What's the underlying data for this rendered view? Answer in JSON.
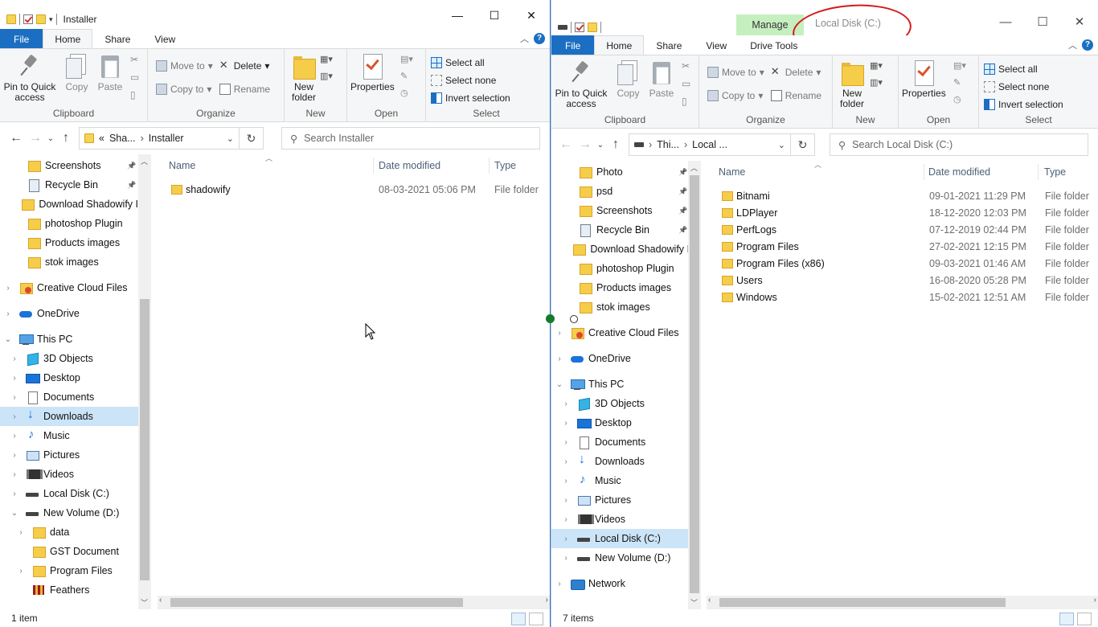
{
  "left": {
    "title": "Installer",
    "window_controls": {
      "minimize": "—",
      "maximize": "☐",
      "close": "✕"
    },
    "tabs": {
      "file": "File",
      "home": "Home",
      "share": "Share",
      "view": "View"
    },
    "ribbon": {
      "clipboard": {
        "label": "Clipboard",
        "pin": "Pin to Quick access",
        "copy": "Copy",
        "paste": "Paste"
      },
      "organize": {
        "label": "Organize",
        "move_to": "Move to",
        "copy_to": "Copy to",
        "delete": "Delete",
        "rename": "Rename"
      },
      "new": {
        "label": "New",
        "new_folder": "New folder"
      },
      "open": {
        "label": "Open",
        "properties": "Properties"
      },
      "select": {
        "label": "Select",
        "select_all": "Select all",
        "select_none": "Select none",
        "invert": "Invert selection"
      }
    },
    "address": {
      "crumb1": "Sha...",
      "crumb2": "Installer",
      "prefix": "«"
    },
    "search_placeholder": "Search Installer",
    "nav": [
      {
        "label": "Screenshots",
        "icon": "folder",
        "pinned": true
      },
      {
        "label": "Recycle Bin",
        "icon": "recycle-bin",
        "pinned": true
      },
      {
        "label": "Download Shadowify I",
        "icon": "folder"
      },
      {
        "label": "photoshop Plugin",
        "icon": "folder"
      },
      {
        "label": "Products images",
        "icon": "folder"
      },
      {
        "label": "stok images",
        "icon": "folder"
      },
      {
        "label": "Creative Cloud Files",
        "icon": "creative-cloud"
      },
      {
        "label": "OneDrive",
        "icon": "onedrive"
      },
      {
        "label": "This PC",
        "icon": "pc"
      },
      {
        "label": "3D Objects",
        "icon": "3d"
      },
      {
        "label": "Desktop",
        "icon": "desktop"
      },
      {
        "label": "Documents",
        "icon": "documents"
      },
      {
        "label": "Downloads",
        "icon": "downloads"
      },
      {
        "label": "Music",
        "icon": "music"
      },
      {
        "label": "Pictures",
        "icon": "pictures"
      },
      {
        "label": "Videos",
        "icon": "videos"
      },
      {
        "label": "Local Disk (C:)",
        "icon": "drive"
      },
      {
        "label": "New Volume (D:)",
        "icon": "drive"
      },
      {
        "label": "data",
        "icon": "folder"
      },
      {
        "label": "GST Document",
        "icon": "folder"
      },
      {
        "label": "Program Files",
        "icon": "folder"
      },
      {
        "label": "Feathers",
        "icon": "feathers"
      }
    ],
    "columns": {
      "name": "Name",
      "date": "Date modified",
      "type": "Type"
    },
    "files": [
      {
        "name": "shadowify",
        "date": "08-03-2021 05:06 PM",
        "type": "File folder"
      }
    ],
    "status": "1 item"
  },
  "right": {
    "title": "Local Disk (C:)",
    "manage": "Manage",
    "window_controls": {
      "minimize": "—",
      "maximize": "☐",
      "close": "✕"
    },
    "tabs": {
      "file": "File",
      "home": "Home",
      "share": "Share",
      "view": "View",
      "drive_tools": "Drive Tools"
    },
    "ribbon": {
      "clipboard": {
        "label": "Clipboard",
        "pin": "Pin to Quick access",
        "copy": "Copy",
        "paste": "Paste"
      },
      "organize": {
        "label": "Organize",
        "move_to": "Move to",
        "copy_to": "Copy to",
        "delete": "Delete",
        "rename": "Rename"
      },
      "new": {
        "label": "New",
        "new_folder": "New folder"
      },
      "open": {
        "label": "Open",
        "properties": "Properties"
      },
      "select": {
        "label": "Select",
        "select_all": "Select all",
        "select_none": "Select none",
        "invert": "Invert selection"
      }
    },
    "address": {
      "crumb1": "Thi...",
      "crumb2": "Local ..."
    },
    "search_placeholder": "Search Local Disk (C:)",
    "nav": [
      {
        "label": "Photo",
        "icon": "folder",
        "pinned": true
      },
      {
        "label": "psd",
        "icon": "folder",
        "pinned": true
      },
      {
        "label": "Screenshots",
        "icon": "folder",
        "pinned": true
      },
      {
        "label": "Recycle Bin",
        "icon": "recycle-bin",
        "pinned": true
      },
      {
        "label": "Download Shadowify I",
        "icon": "folder"
      },
      {
        "label": "photoshop Plugin",
        "icon": "folder"
      },
      {
        "label": "Products images",
        "icon": "folder"
      },
      {
        "label": "stok images",
        "icon": "folder"
      },
      {
        "label": "Creative Cloud Files",
        "icon": "creative-cloud"
      },
      {
        "label": "OneDrive",
        "icon": "onedrive"
      },
      {
        "label": "This PC",
        "icon": "pc"
      },
      {
        "label": "3D Objects",
        "icon": "3d"
      },
      {
        "label": "Desktop",
        "icon": "desktop"
      },
      {
        "label": "Documents",
        "icon": "documents"
      },
      {
        "label": "Downloads",
        "icon": "downloads"
      },
      {
        "label": "Music",
        "icon": "music"
      },
      {
        "label": "Pictures",
        "icon": "pictures"
      },
      {
        "label": "Videos",
        "icon": "videos"
      },
      {
        "label": "Local Disk (C:)",
        "icon": "drive"
      },
      {
        "label": "New Volume (D:)",
        "icon": "drive"
      },
      {
        "label": "Network",
        "icon": "network"
      }
    ],
    "columns": {
      "name": "Name",
      "date": "Date modified",
      "type": "Type"
    },
    "files": [
      {
        "name": "Bitnami",
        "date": "09-01-2021 11:29 PM",
        "type": "File folder"
      },
      {
        "name": "LDPlayer",
        "date": "18-12-2020 12:03 PM",
        "type": "File folder"
      },
      {
        "name": "PerfLogs",
        "date": "07-12-2019 02:44 PM",
        "type": "File folder"
      },
      {
        "name": "Program Files",
        "date": "27-02-2021 12:15 PM",
        "type": "File folder"
      },
      {
        "name": "Program Files (x86)",
        "date": "09-03-2021 01:46 AM",
        "type": "File folder"
      },
      {
        "name": "Users",
        "date": "16-08-2020 05:28 PM",
        "type": "File folder"
      },
      {
        "name": "Windows",
        "date": "15-02-2021 12:51 AM",
        "type": "File folder"
      }
    ],
    "status": "7 items"
  },
  "colors": {
    "accent": "#1b6ec2",
    "selection": "#cce4f7",
    "manage_tab": "#c6efc0",
    "annotation": "#d31b1b"
  }
}
